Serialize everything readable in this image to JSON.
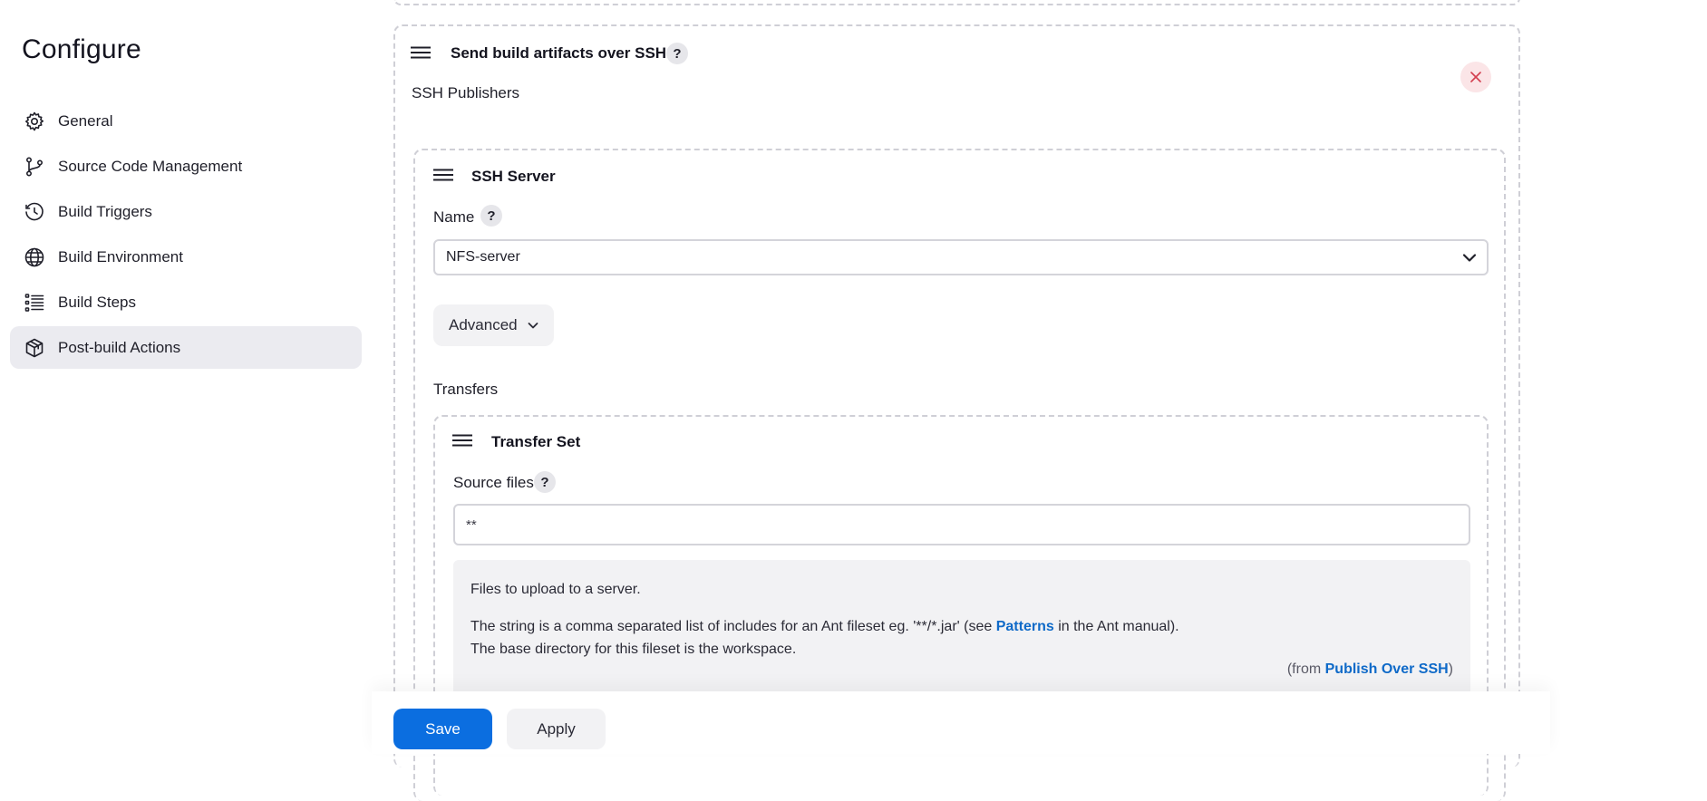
{
  "page": {
    "title": "Configure"
  },
  "sidebar": {
    "items": [
      {
        "label": "General",
        "icon": "gear-icon",
        "active": false
      },
      {
        "label": "Source Code Management",
        "icon": "branch-icon",
        "active": false
      },
      {
        "label": "Build Triggers",
        "icon": "clock-icon",
        "active": false
      },
      {
        "label": "Build Environment",
        "icon": "globe-icon",
        "active": false
      },
      {
        "label": "Build Steps",
        "icon": "list-icon",
        "active": false
      },
      {
        "label": "Post-build Actions",
        "icon": "package-icon",
        "active": true
      }
    ]
  },
  "publisher": {
    "title": "Send build artifacts over SSH",
    "help": "?",
    "close_icon": "close-icon",
    "ssh_publishers_label": "SSH Publishers"
  },
  "server": {
    "title": "SSH Server",
    "name_label": "Name",
    "name_help": "?",
    "name_value": "NFS-server",
    "advanced_label": "Advanced",
    "transfers_label": "Transfers"
  },
  "transfer": {
    "title": "Transfer Set",
    "source_files_label": "Source files",
    "source_files_help": "?",
    "source_files_value": "**",
    "help": {
      "line1": "Files to upload to a server.",
      "line2_before": "The string is a comma separated list of includes for an Ant fileset eg. '**/*.jar' (see ",
      "line2_link": "Patterns",
      "line2_after": " in the Ant manual).",
      "line3": "The base directory for this fileset is the workspace.",
      "from_prefix": "(from ",
      "from_link": "Publish Over SSH",
      "from_suffix": ")"
    }
  },
  "actions": {
    "save_label": "Save",
    "apply_label": "Apply"
  },
  "colors": {
    "primary": "#0b6ee0",
    "link": "#0f6ac8",
    "danger": "#d33f4f",
    "active_nav_bg": "#ebebf0"
  }
}
